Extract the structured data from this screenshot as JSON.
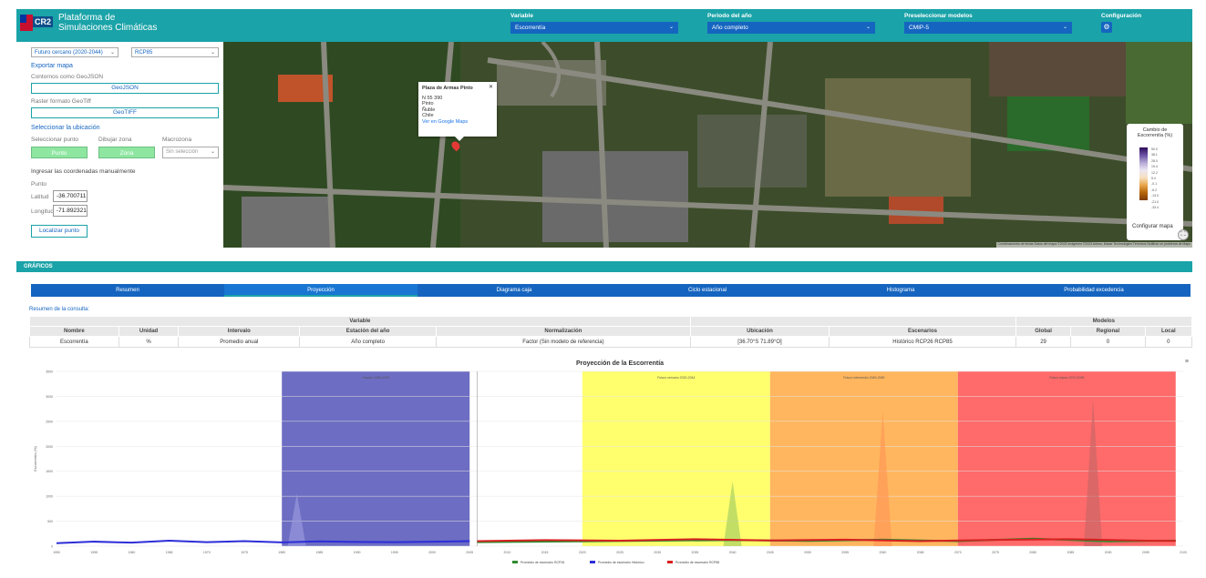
{
  "app": {
    "title_line1": "Plataforma de",
    "title_line2": "Simulaciones Climáticas",
    "logo_text": "CR2"
  },
  "header": {
    "variable": {
      "label": "Variable",
      "value": "Escorrentía"
    },
    "periodo": {
      "label": "Periodo del año",
      "value": "Año completo"
    },
    "modelos": {
      "label": "Preseleccionar modelos",
      "value": "CMIP-5"
    },
    "config": {
      "label": "Configuración"
    }
  },
  "left": {
    "period_select": "Futuro cercano (2020-2044)",
    "scenario_select": "RCP85",
    "export_title": "Exportar mapa",
    "geojson_label": "Contornos como GeoJSON",
    "geojson_btn": "GeoJSON",
    "geotiff_label": "Raster formato GeoTiff",
    "geotiff_btn": "GeoTIFF",
    "location_title": "Seleccionar la ubicación",
    "sel_point_label": "Seleccionar punto",
    "draw_zone_label": "Dibujar zona",
    "macrozone_label": "Macrozona",
    "point_btn": "Punto",
    "zone_btn": "Zona",
    "macrozone_select": "Sin selección",
    "manual_label": "Ingresar las coordenadas manualmente",
    "point_label": "Punto",
    "lat_label": "Latitud",
    "lat_value": "-36.700711",
    "lon_label": "Longitud",
    "lon_value": "-71.892321",
    "locate_btn": "Localizar punto"
  },
  "map": {
    "popup_title": "Plaza de Armas Pinto",
    "popup_addr1": "N 55 390",
    "popup_addr2": "Pinto",
    "popup_addr3": "Ñuble",
    "popup_addr4": "Chile",
    "popup_link": "Ver en Google Maps",
    "legend_title1": "Cambio de",
    "legend_title2": "Escorrentía (%)",
    "legend_values": [
      "50.0",
      "38.1",
      "28.0",
      "19.4",
      "12.2",
      "5.4",
      "-0.1",
      "-6.2",
      "-13.0",
      "-21.0",
      "-33.4"
    ],
    "config_btn": "Configurar mapa",
    "attribution": "Combinaciones de teclas  Datos del mapa ©2023 Imágenes ©2023 Airbus, Maxar Technologies  Términos  Notificar un problema de Maps"
  },
  "graficos": {
    "title": "GRÁFICOS"
  },
  "tabs": [
    "Resumen",
    "Proyección",
    "Diagrama caja",
    "Ciclo estacional",
    "Histograma",
    "Probabilidad excedencia"
  ],
  "summary": {
    "label": "Resumen de la consulta:",
    "group_variable": "Variable",
    "group_modelos": "Modelos",
    "columns": [
      "Nombre",
      "Unidad",
      "Intervalo",
      "Estación del año",
      "Normalización",
      "Ubicación",
      "Escenarios",
      "Global",
      "Regional",
      "Local"
    ],
    "row": [
      "Escorrentía",
      "%",
      "Promedio anual",
      "Año completo",
      "Factor (Sin modelo de referencia)",
      "[36.70°S 71.89°O]",
      "Histórico RCP26 RCP85",
      "29",
      "0",
      "0"
    ]
  },
  "chart_data": {
    "type": "area",
    "title": "Proyección de la Escorrentía",
    "ylabel": "Escorrentía (%)",
    "ylim": [
      0,
      3500
    ],
    "yticks": [
      0,
      500,
      1000,
      1500,
      2000,
      2500,
      3000,
      3500
    ],
    "xlim": [
      1950,
      2100
    ],
    "xticks": [
      1950,
      1955,
      1960,
      1965,
      1970,
      1975,
      1980,
      1985,
      1990,
      1995,
      2000,
      2005,
      2010,
      2015,
      2020,
      2025,
      2030,
      2035,
      2040,
      2045,
      2050,
      2055,
      2060,
      2065,
      2070,
      2075,
      2080,
      2085,
      2090,
      2095,
      2100
    ],
    "bands": [
      {
        "label": "Pasado 1980-2005",
        "from": 1980,
        "to": 2005,
        "color": "#6565c0"
      },
      {
        "label": "Futuro cercano 2020-2044",
        "from": 2020,
        "to": 2045,
        "color": "#ffff66"
      },
      {
        "label": "Futuro intermedio 2045-2069",
        "from": 2045,
        "to": 2070,
        "color": "#ffb255"
      },
      {
        "label": "Futuro lejano 2070-2099",
        "from": 2070,
        "to": 2099,
        "color": "#ff6262"
      }
    ],
    "series": [
      {
        "name": "Promedio de escenario RCP26",
        "color": "#2e8b2e",
        "x": [
          2006,
          2020,
          2030,
          2040,
          2050,
          2060,
          2070,
          2080,
          2090,
          2099
        ],
        "values": [
          80,
          95,
          110,
          120,
          105,
          130,
          100,
          150,
          95,
          110
        ]
      },
      {
        "name": "Promedio de escenario Histórico",
        "color": "#2d2dd8",
        "x": [
          1950,
          1955,
          1960,
          1965,
          1970,
          1975,
          1980,
          1985,
          1990,
          1995,
          2000,
          2005
        ],
        "values": [
          60,
          90,
          70,
          110,
          80,
          100,
          75,
          95,
          85,
          80,
          90,
          100
        ]
      },
      {
        "name": "Promedio de escenario RCP85",
        "color": "#d82020",
        "x": [
          2006,
          2015,
          2025,
          2035,
          2045,
          2055,
          2065,
          2075,
          2085,
          2095,
          2099
        ],
        "values": [
          100,
          120,
          110,
          140,
          115,
          130,
          100,
          125,
          140,
          110,
          105
        ]
      }
    ],
    "peaks": [
      {
        "x": 2060,
        "y": 2700,
        "color": "#ff9955"
      },
      {
        "x": 2088,
        "y": 2950,
        "color": "#cc6666"
      },
      {
        "x": 2040,
        "y": 1300,
        "color": "#aad060"
      },
      {
        "x": 1982,
        "y": 1050,
        "color": "#9999dd"
      }
    ]
  }
}
